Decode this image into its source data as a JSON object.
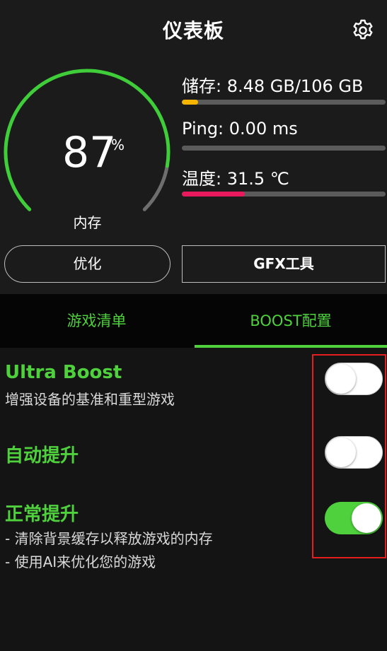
{
  "header": {
    "title": "仪表板",
    "settings_icon": "gear-icon"
  },
  "gauge": {
    "value": "87",
    "unit": "%",
    "label": "内存",
    "percent": 87,
    "color_used": "#3fcd3a",
    "color_free": "#6e6e6e"
  },
  "stats": {
    "storage": {
      "label": "储存: 8.48 GB/106 GB",
      "fill": 0.08,
      "color": "#f5b400"
    },
    "ping": {
      "label": "Ping: 0.00 ms",
      "fill": 0,
      "color": "#4fd13d"
    },
    "temperature": {
      "label": "温度: 31.5 ℃",
      "fill": 0.31,
      "color": "#e8195c"
    }
  },
  "buttons": {
    "optimize": "优化",
    "gfx_tool": "GFX工具"
  },
  "tabs": {
    "games": "游戏清单",
    "boost": "BOOST配置",
    "active": "boost"
  },
  "options": [
    {
      "title": "Ultra Boost",
      "desc": "增强设备的基准和重型游戏",
      "enabled": false
    },
    {
      "title": "自动提升",
      "enabled": false
    },
    {
      "title": "正常提升",
      "desc_1": "- 清除背景缓存以释放游戏的内存",
      "desc_2": "- 使用AI来优化您的游戏",
      "enabled": true
    }
  ],
  "colors": {
    "accent": "#4fd13d",
    "highlight_box": "#e51d1d"
  }
}
